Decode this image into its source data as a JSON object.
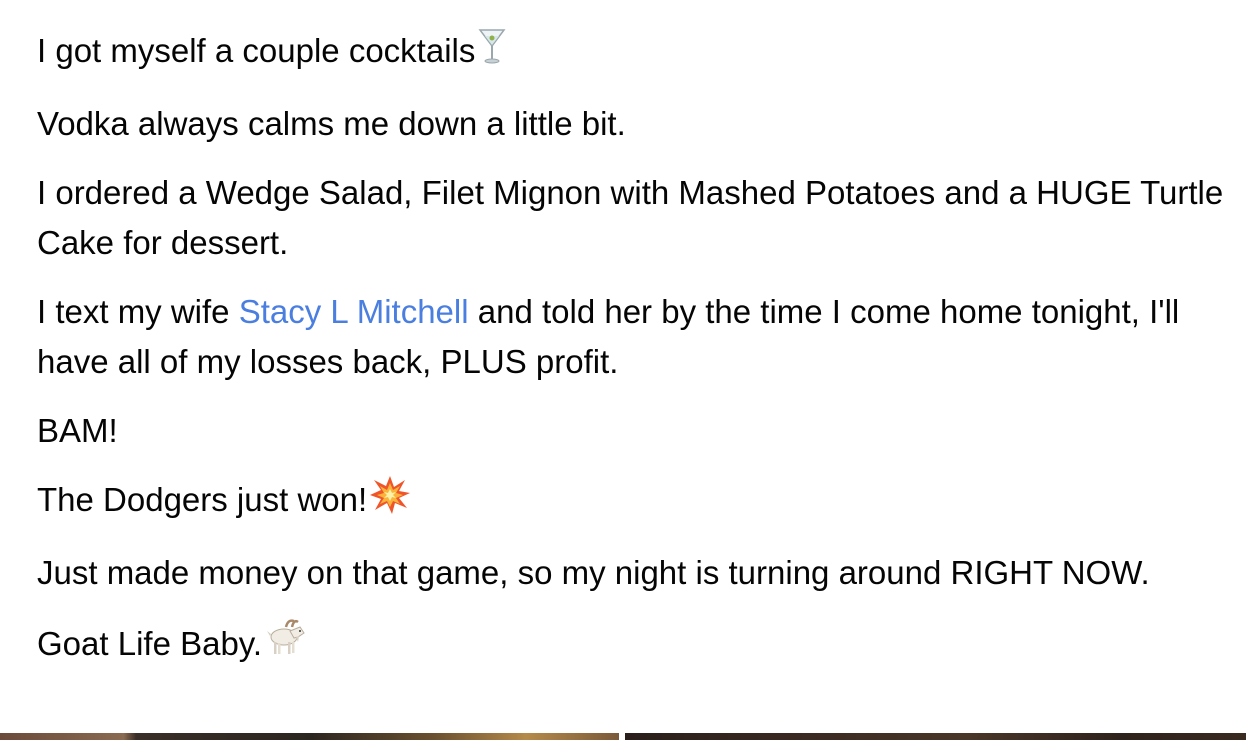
{
  "post": {
    "paragraphs": [
      {
        "text": "I got myself a couple cocktails",
        "emoji": "cocktail-glass-icon"
      },
      {
        "text": "Vodka always calms me down a little bit."
      },
      {
        "text": "I ordered a Wedge Salad, Filet Mignon with Mashed Potatoes and a HUGE Turtle Cake for dessert."
      },
      {
        "before": "I text my wife ",
        "mention": "Stacy L Mitchell",
        "after": " and told her by the time I come home tonight, I'll have all of my losses back, PLUS profit."
      },
      {
        "text": "BAM!"
      },
      {
        "text": "The Dodgers just won!",
        "emoji": "collision-icon"
      },
      {
        "text": "Just made money on that game, so my night is turning around RIGHT NOW."
      },
      {
        "text": "Goat Life Baby.",
        "emoji": "goat-icon"
      }
    ]
  },
  "colors": {
    "text": "#050505",
    "mention": "#4a7fe0",
    "background": "#ffffff"
  }
}
